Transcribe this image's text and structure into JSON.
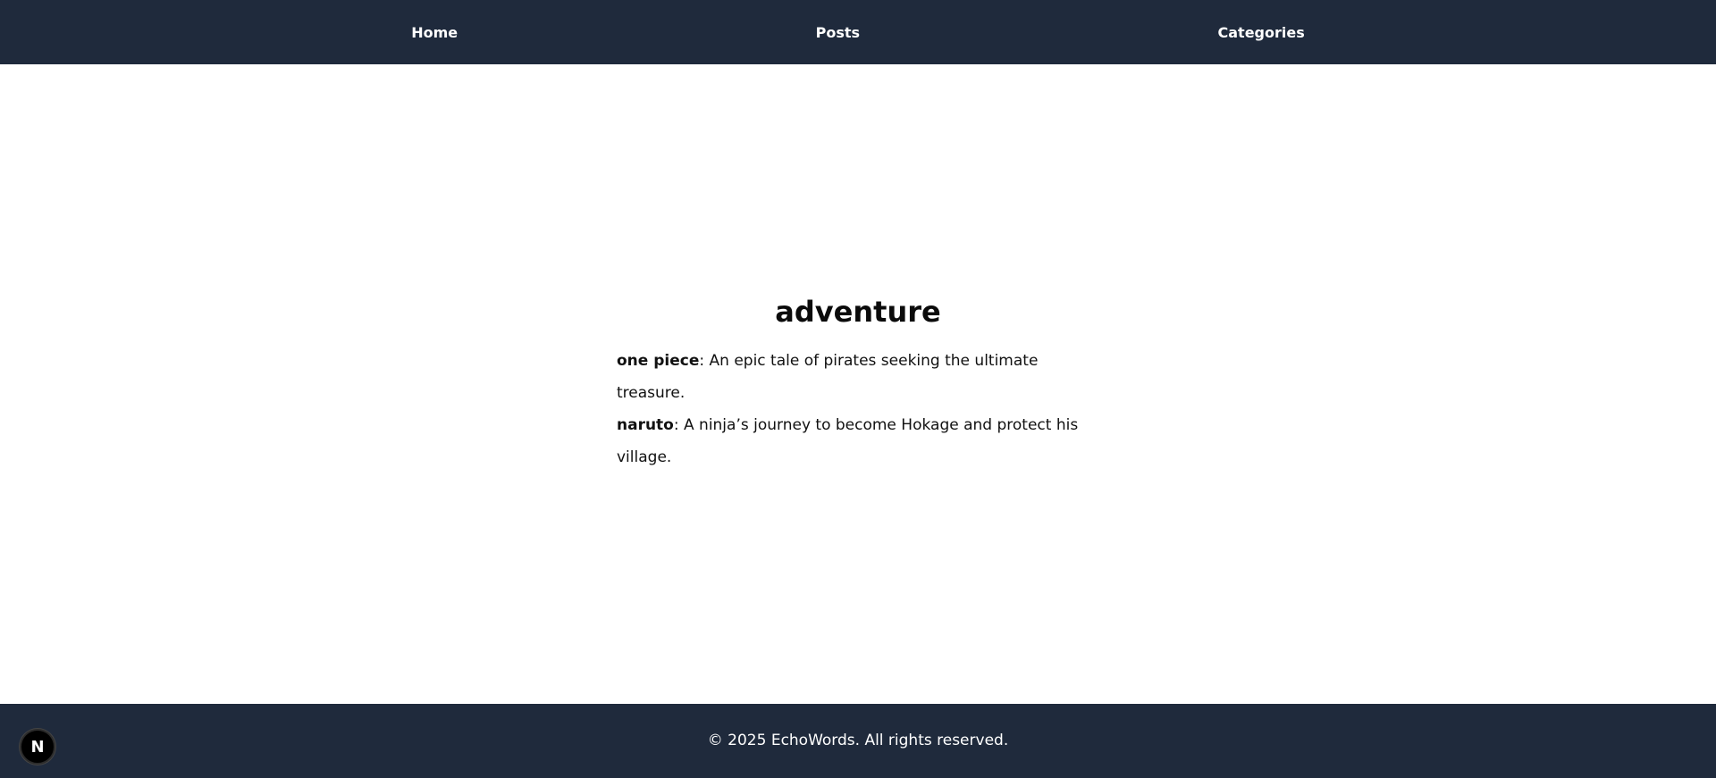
{
  "nav": {
    "items": [
      {
        "label": "Home"
      },
      {
        "label": "Posts"
      },
      {
        "label": "Categories"
      }
    ]
  },
  "main": {
    "title": "adventure",
    "entries": [
      {
        "name": "one piece",
        "description": ": An epic tale of pirates seeking the ultimate treasure."
      },
      {
        "name": "naruto",
        "description": ": A ninja’s journey to become Hokage and protect his village."
      }
    ]
  },
  "footer": {
    "text": "© 2025 EchoWords. All rights reserved."
  },
  "badge": {
    "letter": "N"
  },
  "colors": {
    "header_bg": "#1f2a3c",
    "footer_bg": "#1f2a3c"
  }
}
